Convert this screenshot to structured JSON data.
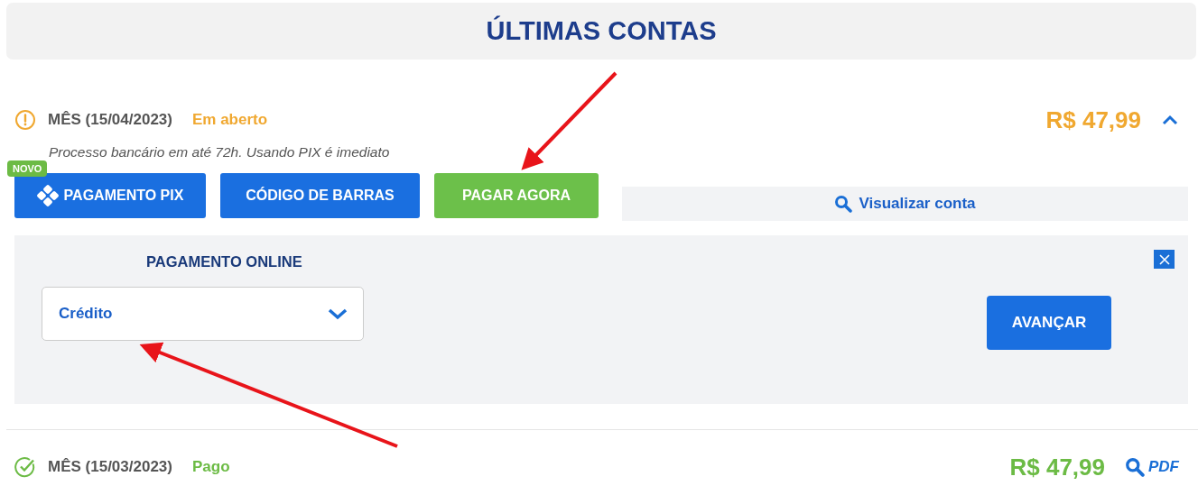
{
  "title": "ÚLTIMAS CONTAS",
  "bills": [
    {
      "label": "MÊS (15/04/2023)",
      "kind": "open",
      "status_text": "Em aberto",
      "amount": "R$ 47,99",
      "expanded": true,
      "note": "Processo bancário em até 72h. Usando PIX é imediato",
      "actions": [
        {
          "kind": "pix",
          "label": "PAGAMENTO PIX",
          "badge": "NOVO"
        },
        {
          "kind": "barcode",
          "label": "CÓDIGO DE BARRAS"
        },
        {
          "kind": "pay",
          "label": "PAGAR AGORA"
        }
      ],
      "view_link": "Visualizar conta",
      "payment_panel": {
        "title": "PAGAMENTO ONLINE",
        "method": "Crédito",
        "submit": "AVANÇAR"
      }
    },
    {
      "label": "MÊS (15/03/2023)",
      "kind": "paid",
      "status_text": "Pago",
      "amount": "R$ 47,99",
      "pdf_link": "PDF"
    }
  ]
}
